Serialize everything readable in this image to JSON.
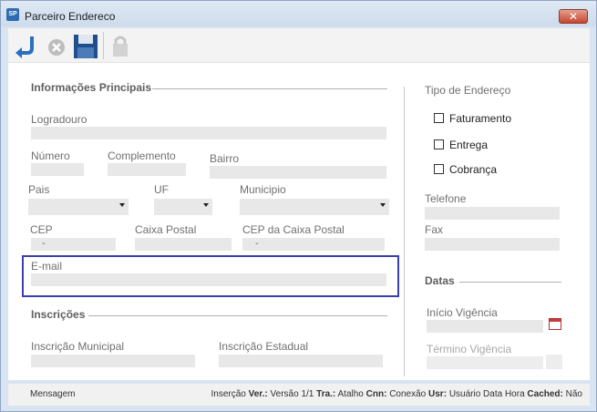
{
  "window": {
    "title": "Parceiro Endereco",
    "app_icon_text": "SP",
    "close_symbol": "✕"
  },
  "toolbar": {
    "buttons": [
      {
        "icon": "return-icon"
      },
      {
        "icon": "cancel-icon"
      },
      {
        "icon": "save-icon"
      },
      {
        "icon": "lock-icon"
      }
    ]
  },
  "sections": {
    "principal": "Informações Principais",
    "inscricoes": "Inscrições",
    "datas": "Datas"
  },
  "fields": {
    "logradouro": "Logradouro",
    "numero": "Número",
    "complemento": "Complemento",
    "bairro": "Bairro",
    "pais": "Pais",
    "uf": "UF",
    "municipio": "Municipio",
    "cep": "CEP",
    "cep_value": "-",
    "caixa_postal": "Caixa Postal",
    "cep_caixa_postal": "CEP da Caixa Postal",
    "cep_caixa_postal_value": "-",
    "email": "E-mail",
    "inscricao_municipal": "Inscrição Municipal",
    "inscricao_estadual": "Inscrição Estadual"
  },
  "tipo_endereco": {
    "title": "Tipo de Endereço",
    "options": [
      "Faturamento",
      "Entrega",
      "Cobrança"
    ]
  },
  "contato": {
    "telefone": "Telefone",
    "fax": "Fax"
  },
  "datas": {
    "inicio": "Início Vigência",
    "termino": "Término Vigência"
  },
  "statusbar": {
    "message": "Mensagem",
    "insercao": "Inserção",
    "ver_label": "Ver.:",
    "ver_value": "Versão 1/1",
    "tra_label": "Tra.:",
    "tra_value": "Atalho",
    "cnn_label": "Cnn:",
    "cnn_value": "Conexão",
    "usr_label": "Usr:",
    "usr_value": "Usuário Data Hora",
    "cached_label": "Cached:",
    "cached_value": "Não"
  },
  "colors": {
    "highlight_border": "#3a3fb0",
    "field_bg": "#e8e8e8"
  }
}
